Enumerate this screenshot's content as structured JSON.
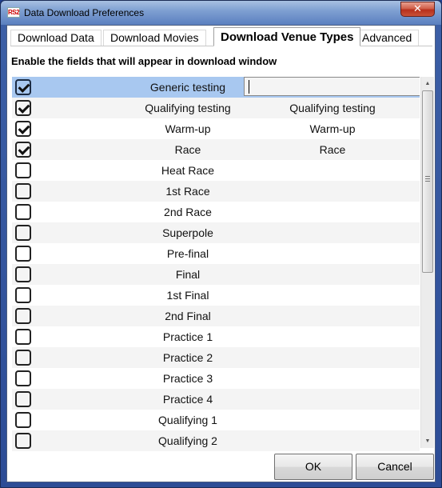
{
  "window": {
    "title": "Data Download Preferences",
    "app_icon": "app-logo-icon",
    "close_glyph": "✕"
  },
  "tabs": [
    {
      "label": "Download Data",
      "active": false
    },
    {
      "label": "Download Movies",
      "active": false
    },
    {
      "label": "Download Venue Types",
      "active": true
    },
    {
      "label": "Advanced",
      "active": false
    }
  ],
  "instruction": "Enable the fields that will appear in download window",
  "venue_types": [
    {
      "name": "Generic testing",
      "enabled": true,
      "alias": "",
      "selected": true,
      "editing": true
    },
    {
      "name": "Qualifying testing",
      "enabled": true,
      "alias": "Qualifying testing"
    },
    {
      "name": "Warm-up",
      "enabled": true,
      "alias": "Warm-up"
    },
    {
      "name": "Race",
      "enabled": true,
      "alias": "Race"
    },
    {
      "name": "Heat Race",
      "enabled": false,
      "alias": ""
    },
    {
      "name": "1st Race",
      "enabled": false,
      "alias": ""
    },
    {
      "name": "2nd Race",
      "enabled": false,
      "alias": ""
    },
    {
      "name": "Superpole",
      "enabled": false,
      "alias": ""
    },
    {
      "name": "Pre-final",
      "enabled": false,
      "alias": ""
    },
    {
      "name": "Final",
      "enabled": false,
      "alias": ""
    },
    {
      "name": "1st Final",
      "enabled": false,
      "alias": ""
    },
    {
      "name": "2nd Final",
      "enabled": false,
      "alias": ""
    },
    {
      "name": "Practice 1",
      "enabled": false,
      "alias": ""
    },
    {
      "name": "Practice 2",
      "enabled": false,
      "alias": ""
    },
    {
      "name": "Practice 3",
      "enabled": false,
      "alias": ""
    },
    {
      "name": "Practice 4",
      "enabled": false,
      "alias": ""
    },
    {
      "name": "Qualifying 1",
      "enabled": false,
      "alias": ""
    },
    {
      "name": "Qualifying 2",
      "enabled": false,
      "alias": ""
    }
  ],
  "scrollbar": {
    "up_glyph": "▲",
    "down_glyph": "▼",
    "position_fraction": 0.0,
    "visible_fraction": 0.5
  },
  "buttons": {
    "ok": "OK",
    "cancel": "Cancel"
  },
  "colors": {
    "selected_row": "#a8c8f0",
    "alt_row": "#f4f4f4",
    "title_bar": "#5a7fbf",
    "close_button": "#c85038"
  }
}
